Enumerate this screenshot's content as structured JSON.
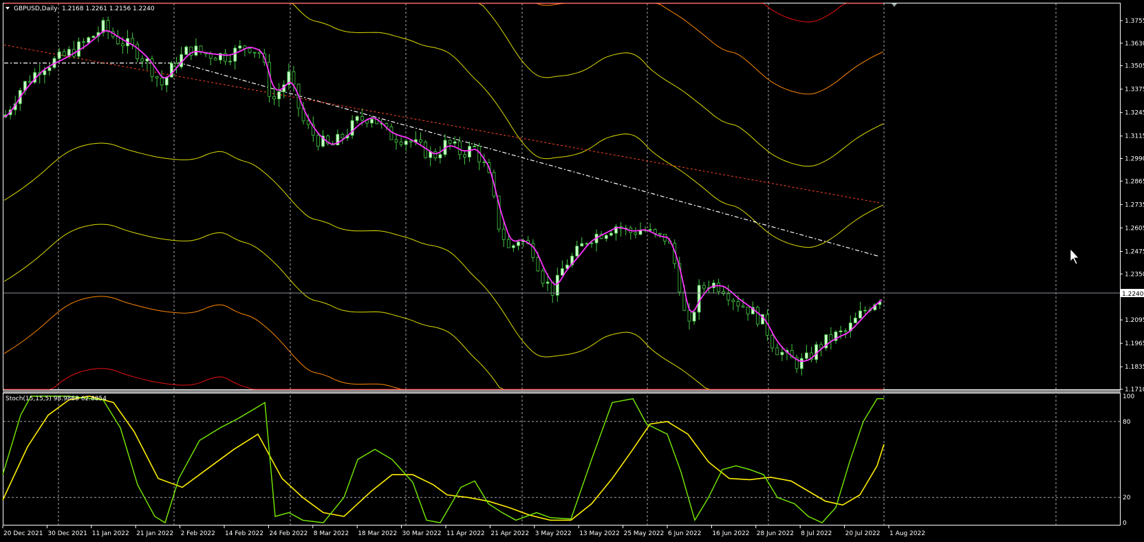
{
  "header": {
    "symbol": "GBPUSD,Daily",
    "ohlc": "1.2168 1.2261 1.2156 1.2240"
  },
  "price_axis": {
    "labels": [
      "1.3755",
      "1.3630",
      "1.3505",
      "1.3375",
      "1.3245",
      "1.3115",
      "1.2990",
      "1.2865",
      "1.2735",
      "1.2605",
      "1.2475",
      "1.2350",
      "1.2095",
      "1.1965",
      "1.1835",
      "1.1710"
    ],
    "current_price": "1.2240"
  },
  "stoch": {
    "caption": "Stoch(15,15,5) 98.9868 62.8854",
    "levels": [
      "100",
      "80",
      "20",
      "0"
    ]
  },
  "time_axis": {
    "labels": [
      "20 Dec 2021",
      "30 Dec 2021",
      "11 Jan 2022",
      "21 Jan 2022",
      "2 Feb 2022",
      "14 Feb 2022",
      "24 Feb 2022",
      "8 Mar 2022",
      "18 Mar 2022",
      "30 Mar 2022",
      "11 Apr 2022",
      "21 Apr 2022",
      "3 May 2022",
      "13 May 2022",
      "25 May 2022",
      "6 Jun 2022",
      "16 Jun 2022",
      "28 Jun 2022",
      "8 Jul 2022",
      "20 Jul 2022",
      "1 Aug 2022"
    ]
  },
  "colors": {
    "background": "#000000",
    "candle_up": "#ccffcc",
    "candle_down": "#000000",
    "wick": "#44cc44",
    "ma": "#ff33ff",
    "band_yellow": "#dddd00",
    "band_orange": "#ff8800",
    "band_red": "#ee1111",
    "sma_dashed": "#ffffff",
    "sma_red_dashed": "#ff4422",
    "stoch_main": "#77ee00",
    "stoch_signal": "#ffee00",
    "grid": "#aaaaaa"
  }
}
